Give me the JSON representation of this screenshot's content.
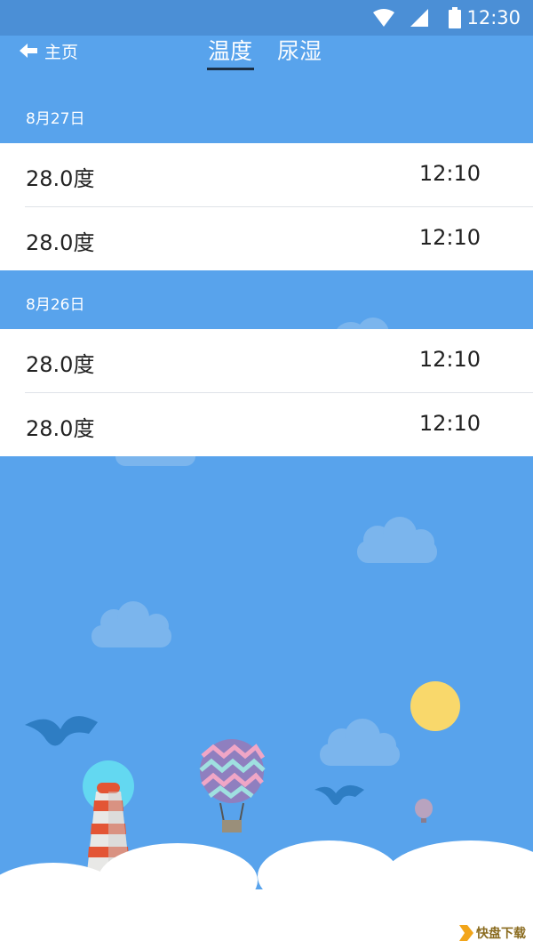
{
  "status_bar": {
    "time": "12:30",
    "icons": [
      "wifi-icon",
      "signal-icon",
      "battery-icon"
    ]
  },
  "header": {
    "back_label": "主页",
    "tabs": [
      {
        "label": "温度",
        "active": true
      },
      {
        "label": "尿湿",
        "active": false
      }
    ]
  },
  "groups": [
    {
      "date": "8月27日",
      "rows": [
        {
          "value": "28.0度",
          "time": "12:10"
        },
        {
          "value": "28.0度",
          "time": "12:10"
        }
      ]
    },
    {
      "date": "8月26日",
      "rows": [
        {
          "value": "28.0度",
          "time": "12:10"
        },
        {
          "value": "28.0度",
          "time": "12:10"
        }
      ]
    }
  ],
  "watermark": {
    "text": "快盘下载"
  },
  "colors": {
    "sky": "#58a3ec",
    "status_bar": "#4b8fd6",
    "sun": "#f9d86b",
    "tab_underline": "#1b2f45"
  }
}
